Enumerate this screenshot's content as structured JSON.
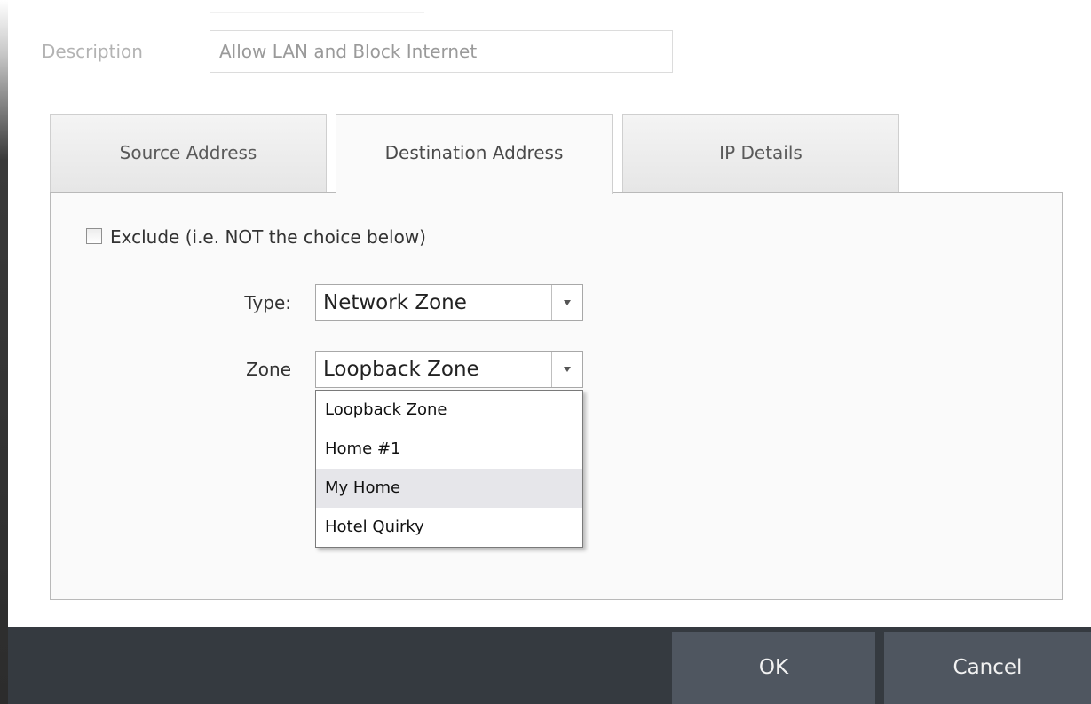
{
  "description": {
    "label": "Description",
    "value": "Allow LAN and Block Internet"
  },
  "tabs": [
    {
      "label": "Source Address",
      "active": false
    },
    {
      "label": "Destination Address",
      "active": true
    },
    {
      "label": "IP Details",
      "active": false
    }
  ],
  "exclude": {
    "label": "Exclude (i.e. NOT the choice below)",
    "checked": false
  },
  "type_field": {
    "label": "Type:",
    "value": "Network Zone"
  },
  "zone_field": {
    "label": "Zone",
    "value": "Loopback Zone",
    "options": [
      "Loopback Zone",
      "Home #1",
      "My Home",
      "Hotel Quirky"
    ],
    "hovered_option": "My Home"
  },
  "footer": {
    "ok_label": "OK",
    "cancel_label": "Cancel"
  },
  "colors": {
    "footer_bg": "#353a40",
    "button_bg": "#4f5660",
    "hover_bg": "#e6e6ea"
  }
}
